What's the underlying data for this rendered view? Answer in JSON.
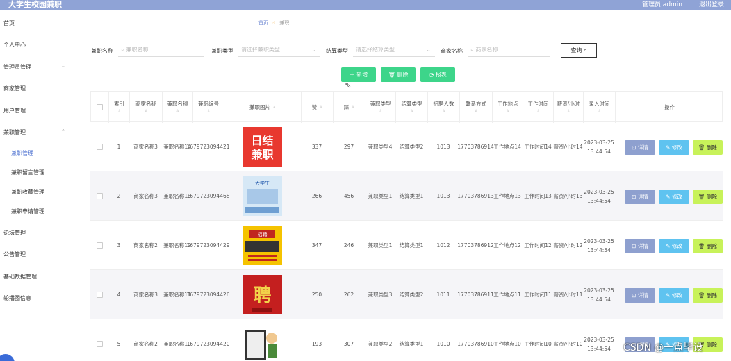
{
  "header": {
    "title": "大学生校园兼职",
    "user": "管理员 admin",
    "logout": "退出登录"
  },
  "sidebar": {
    "items": [
      {
        "label": "首页"
      },
      {
        "label": "个人中心"
      },
      {
        "label": "管理员管理"
      },
      {
        "label": "商家管理"
      },
      {
        "label": "用户管理"
      },
      {
        "label": "兼职管理"
      }
    ],
    "subitems": [
      {
        "label": "兼职管理"
      },
      {
        "label": "兼职留言管理"
      },
      {
        "label": "兼职收藏管理"
      },
      {
        "label": "兼职申请管理"
      }
    ],
    "bottom": [
      {
        "label": "论坛管理"
      },
      {
        "label": "公告管理"
      },
      {
        "label": "基础数据管理"
      },
      {
        "label": "轮播图信息"
      }
    ]
  },
  "breadcrumb": {
    "home": "首页",
    "current": "兼职"
  },
  "filters": {
    "name_label": "兼职名称",
    "name_placeholder": "兼职名称",
    "type_label": "兼职类型",
    "type_placeholder": "请选择兼职类型",
    "settle_label": "结算类型",
    "settle_placeholder": "请选择结算类型",
    "shop_label": "商家名称",
    "shop_placeholder": "商家名称",
    "query": "查询"
  },
  "actions": {
    "add": "新增",
    "delete": "删除",
    "report": "报表"
  },
  "table": {
    "headers": [
      "索引",
      "商家名称",
      "兼职名称",
      "兼职编号",
      "兼职图片",
      "赞",
      "踩",
      "兼职类型",
      "结算类型",
      "招聘人数",
      "联系方式",
      "工作地点",
      "工作时间",
      "薪资/小时",
      "录入时间",
      "操作"
    ],
    "op_labels": {
      "detail": "详情",
      "edit": "修改",
      "delete": "删除"
    },
    "rows": [
      {
        "idx": "1",
        "shop": "商家名称3",
        "name": "兼职名称14",
        "no": "1679723094421",
        "img": "poster-red-rijie",
        "up": "337",
        "down": "297",
        "type": "兼职类型4",
        "settle": "结算类型2",
        "count": "1013",
        "phone": "17703786914",
        "place": "工作地点14",
        "time": "工作时间14",
        "pay": "薪资/小时14",
        "date": "2023-03-25 13:44:54"
      },
      {
        "idx": "2",
        "shop": "商家名称3",
        "name": "兼职名称13",
        "no": "1679723094468",
        "img": "poster-blue-campus",
        "up": "266",
        "down": "456",
        "type": "兼职类型1",
        "settle": "结算类型1",
        "count": "1013",
        "phone": "17703786913",
        "place": "工作地点13",
        "time": "工作时间13",
        "pay": "薪资/小时13",
        "date": "2023-03-25 13:44:54"
      },
      {
        "idx": "3",
        "shop": "商家名称2",
        "name": "兼职名称12",
        "no": "1679723094429",
        "img": "poster-yellow-hire",
        "up": "347",
        "down": "246",
        "type": "兼职类型1",
        "settle": "结算类型1",
        "count": "1012",
        "phone": "17703786912",
        "place": "工作地点12",
        "time": "工作时间12",
        "pay": "薪资/小时12",
        "date": "2023-03-25 13:44:54"
      },
      {
        "idx": "4",
        "shop": "商家名称3",
        "name": "兼职名称11",
        "no": "1679723094426",
        "img": "poster-red-pin",
        "up": "250",
        "down": "262",
        "type": "兼职类型3",
        "settle": "结算类型2",
        "count": "1011",
        "phone": "17703786911",
        "place": "工作地点11",
        "time": "工作时间11",
        "pay": "薪资/小时11",
        "date": "2023-03-25 13:44:54"
      },
      {
        "idx": "5",
        "shop": "商家名称2",
        "name": "兼职名称10",
        "no": "1679723094420",
        "img": "poster-cartoon",
        "up": "193",
        "down": "307",
        "type": "兼职类型2",
        "settle": "结算类型1",
        "count": "1010",
        "phone": "17703786910",
        "place": "工作地点10",
        "time": "工作时间10",
        "pay": "薪资/小时10",
        "date": "2023-03-25 13:44:54"
      }
    ]
  },
  "watermark": "CSDN @一点毕设"
}
